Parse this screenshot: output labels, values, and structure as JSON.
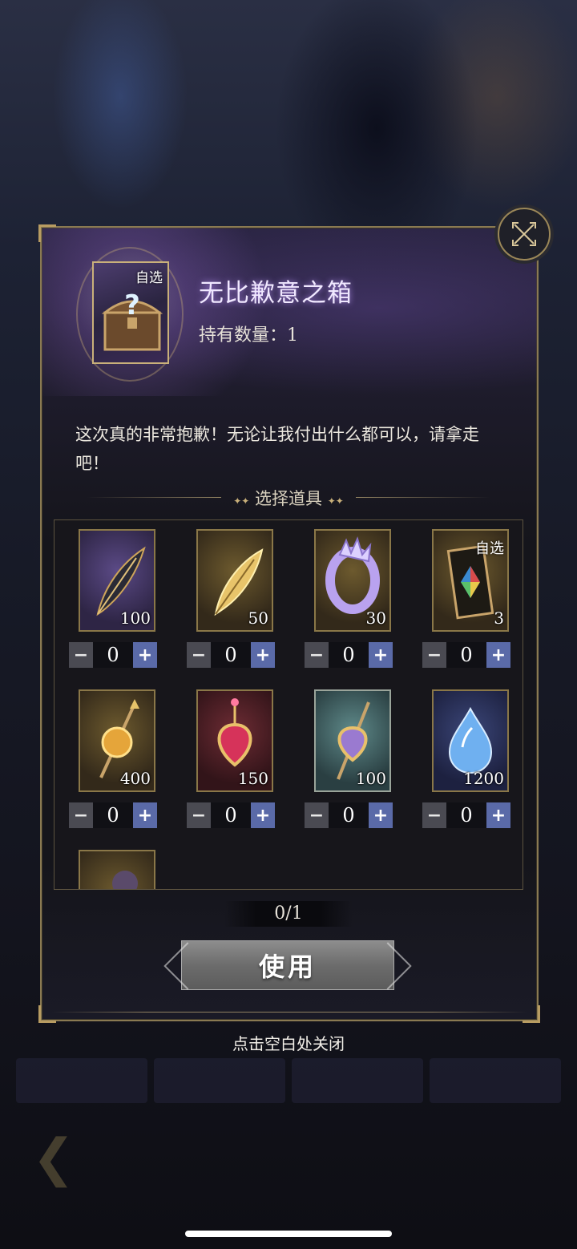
{
  "dialog": {
    "chest_title": "无比歉意之箱",
    "chest_tag": "自选",
    "own_label": "持有数量：",
    "own_count": "1",
    "description": "这次真的非常抱歉！无论让我付出什么都可以，请拿走吧！",
    "section_title": "选择道具",
    "selected_counter": "0/1",
    "use_button": "使用",
    "close_hint": "点击空白处关闭",
    "close_icon": "close-cross-icon"
  },
  "items": [
    {
      "qty": "100",
      "count": "0",
      "icon": "dark-feather-icon",
      "frame": "purple"
    },
    {
      "qty": "50",
      "count": "0",
      "icon": "golden-feather-icon",
      "frame": "gold"
    },
    {
      "qty": "30",
      "count": "0",
      "icon": "crystal-ring-icon",
      "frame": "gold"
    },
    {
      "qty": "3",
      "count": "0",
      "icon": "tarot-card-icon",
      "frame": "gold",
      "tag": "自选"
    },
    {
      "qty": "400",
      "count": "0",
      "icon": "amber-scepter-icon",
      "frame": "gold"
    },
    {
      "qty": "150",
      "count": "0",
      "icon": "ruby-amulet-icon",
      "frame": "red"
    },
    {
      "qty": "100",
      "count": "0",
      "icon": "amethyst-scepter-icon",
      "frame": "teal"
    },
    {
      "qty": "1200",
      "count": "0",
      "icon": "blue-gem-icon",
      "frame": "blue"
    },
    {
      "qty": "",
      "count": "",
      "icon": "partial-item-icon",
      "frame": "gold"
    }
  ],
  "colors": {
    "frame_gold": "#8a7748",
    "plus_button": "#5a6aa8",
    "minus_button": "#4a4a52",
    "title_glow": "#be96ff"
  }
}
